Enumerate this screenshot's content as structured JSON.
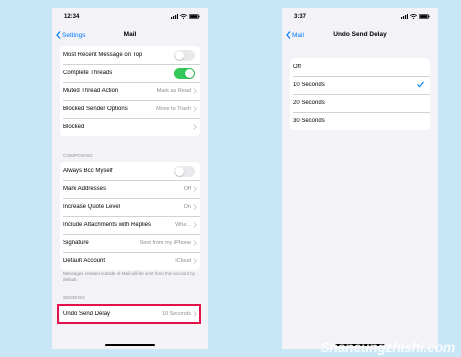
{
  "left": {
    "status": {
      "time": "12:34"
    },
    "nav": {
      "back": "Settings",
      "title": "Mail"
    },
    "group1": [
      {
        "label": "Most Recent Message on Top",
        "kind": "toggle",
        "on": false
      },
      {
        "label": "Complete Threads",
        "kind": "toggle",
        "on": true
      },
      {
        "label": "Muted Thread Action",
        "value": "Mark as Read"
      },
      {
        "label": "Blocked Sender Options",
        "value": "Move to Trash"
      },
      {
        "label": "Blocked",
        "value": ""
      }
    ],
    "composing_header": "COMPOSING",
    "group2": [
      {
        "label": "Always Bcc Myself",
        "kind": "toggle",
        "on": false
      },
      {
        "label": "Mark Addresses",
        "value": "Off"
      },
      {
        "label": "Increase Quote Level",
        "value": "On"
      },
      {
        "label": "Include Attachments with Replies",
        "value": "Whe..."
      },
      {
        "label": "Signature",
        "value": "Sent from my iPhone"
      },
      {
        "label": "Default Account",
        "value": "iCloud"
      }
    ],
    "footnote": "Messages created outside of Mail will be sent from this account by default.",
    "sending_header": "SENDING",
    "group3": [
      {
        "label": "Undo Send Delay",
        "value": "10 Seconds"
      }
    ]
  },
  "right": {
    "status": {
      "time": "3:37"
    },
    "nav": {
      "back": "Mail",
      "title": "Undo Send Delay"
    },
    "options": [
      {
        "label": "Off",
        "selected": false
      },
      {
        "label": "10 Seconds",
        "selected": true
      },
      {
        "label": "20 Seconds",
        "selected": false
      },
      {
        "label": "30 Seconds",
        "selected": false
      }
    ]
  },
  "colors": {
    "background": "#c9e6f7",
    "accent": "#007aff",
    "toggle_on": "#34c759",
    "highlight": "#e3124a"
  },
  "watermark": "Shancungzhishi.com"
}
